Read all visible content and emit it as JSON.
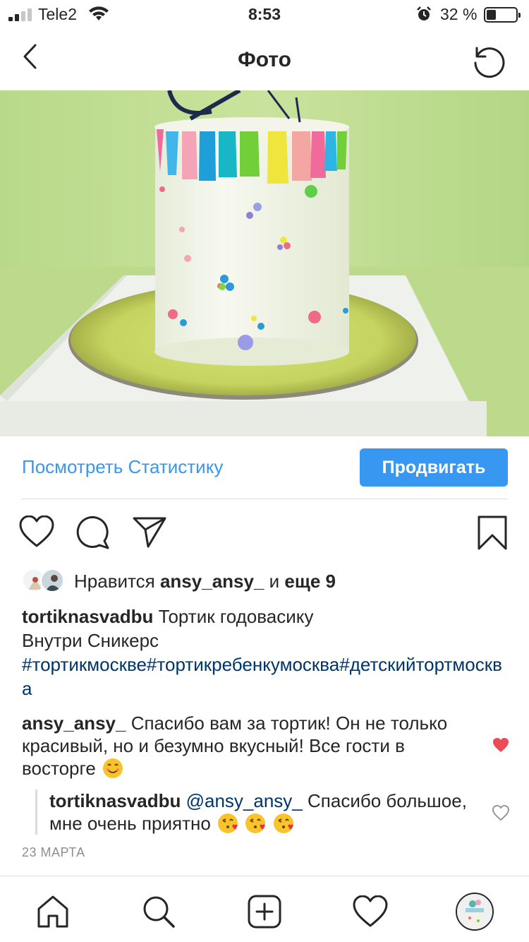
{
  "status_bar": {
    "carrier": "Tele2",
    "time": "8:53",
    "battery_percent": "32 %",
    "battery_level": 0.32
  },
  "nav": {
    "title": "Фото"
  },
  "actions": {
    "stats_label": "Посмотреть Статистику",
    "promote_label": "Продвигать"
  },
  "likes": {
    "prefix": "Нравится",
    "user": "ansy_ansy_",
    "middle": "и",
    "others": "еще 9"
  },
  "caption": {
    "username": "tortiknasvadbu",
    "text_line1": "Тортик годовасику",
    "text_line2": "Внутри Сникерс",
    "hashtags": "#тортикмоскве#тортикребенкумосква#детскийтортмосква"
  },
  "comments": [
    {
      "username": "ansy_ansy_",
      "text": "Спасибо вам за тортик! Он не только красивый, но и безумно вкусный! Все гости в восторге",
      "liked": true
    },
    {
      "username": "tortiknasvadbu",
      "mention": "@ansy_ansy_",
      "text": "Спасибо большое, мне очень приятно",
      "liked": false
    }
  ],
  "post_date": "23 МАРТА",
  "colors": {
    "accent": "#3897f0",
    "hashtag": "#003569",
    "like_red": "#ed4956",
    "secondary_text": "#8e8e8e"
  }
}
